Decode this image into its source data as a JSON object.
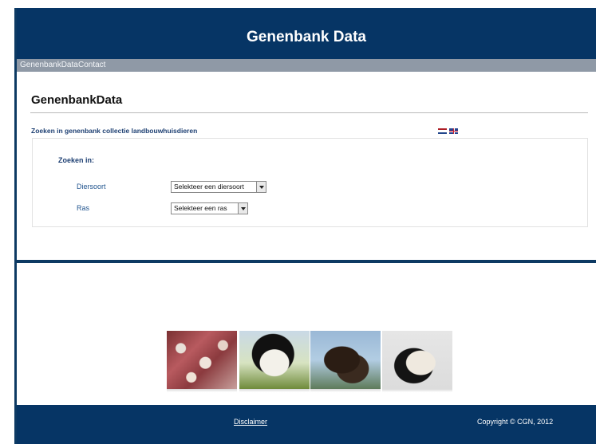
{
  "header": {
    "title": "Genenbank Data"
  },
  "nav": {
    "items": [
      "GenenbankData",
      "Contact"
    ]
  },
  "main": {
    "page_title": "GenenbankData",
    "search_heading": "Zoeken in genenbank collectie landbouwhuisdieren",
    "languages": [
      "nl-flag-icon",
      "uk-flag-icon"
    ],
    "search_in_label": "Zoeken in:",
    "fields": [
      {
        "label": "Diersoort",
        "selected": "Selekteer een diersoort"
      },
      {
        "label": "Ras",
        "selected": "Selekteer een ras"
      }
    ]
  },
  "gallery": {
    "images": [
      "seeds-photo",
      "cow-photo",
      "horse-photo",
      "goat-photo"
    ]
  },
  "footer": {
    "disclaimer": "Disclaimer",
    "copyright": "Copyright © CGN, 2012"
  },
  "colors": {
    "header_bg": "#063565",
    "nav_bg": "#8f99a6",
    "link": "#1d3f72"
  }
}
